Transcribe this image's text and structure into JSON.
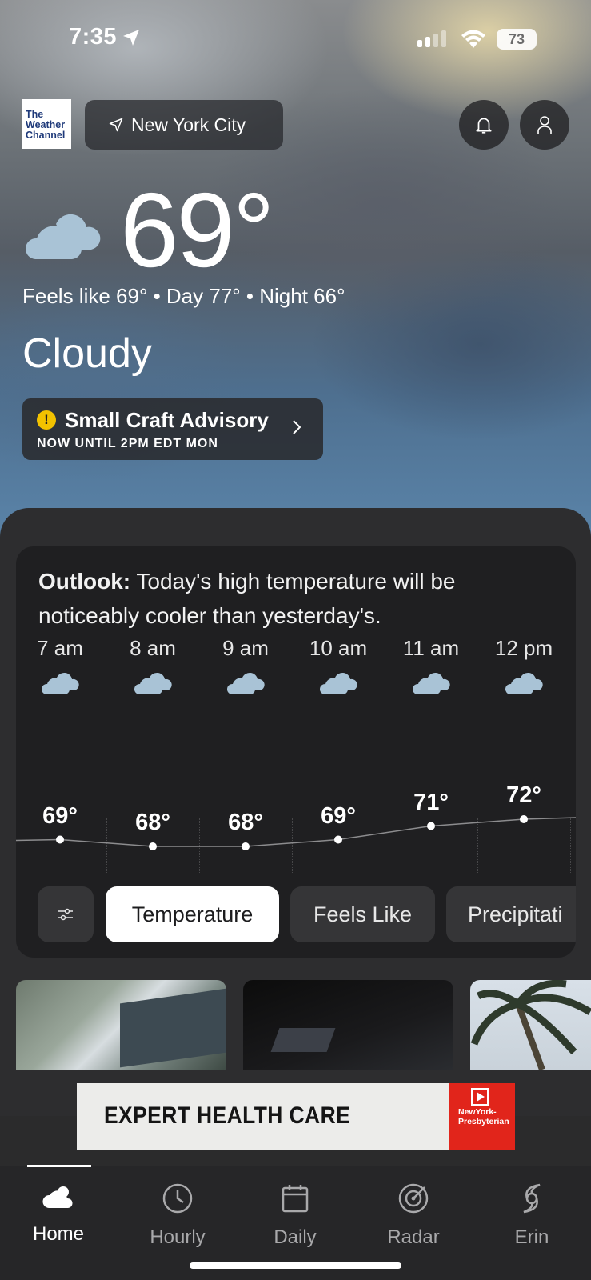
{
  "status_bar": {
    "time": "7:35",
    "battery": "73"
  },
  "header": {
    "logo_line1": "The",
    "logo_line2": "Weather",
    "logo_line3": "Channel",
    "location": "New York City"
  },
  "current": {
    "temperature": "69°",
    "feels_line": "Feels like 69° • Day 77° • Night 66°",
    "condition": "Cloudy"
  },
  "advisory": {
    "title": "Small Craft Advisory",
    "subtitle": "NOW UNTIL 2PM EDT MON"
  },
  "outlook": {
    "label": "Outlook:",
    "text": " Today's high temperature will be noticeably cooler than yesterday's."
  },
  "hourly": [
    {
      "time": "7 am",
      "temp": "69°",
      "value": 69
    },
    {
      "time": "8 am",
      "temp": "68°",
      "value": 68
    },
    {
      "time": "9 am",
      "temp": "68°",
      "value": 68
    },
    {
      "time": "10 am",
      "temp": "69°",
      "value": 69
    },
    {
      "time": "11 am",
      "temp": "71°",
      "value": 71
    },
    {
      "time": "12 pm",
      "temp": "72°",
      "value": 72
    }
  ],
  "chart_pills": {
    "temperature": "Temperature",
    "feels_like": "Feels Like",
    "precipitation": "Precipitati"
  },
  "ad": {
    "headline": "EXPERT HEALTH CARE",
    "brand_line1": "NewYork-",
    "brand_line2": "Presbyterian"
  },
  "tabs": {
    "home": "Home",
    "hourly": "Hourly",
    "daily": "Daily",
    "radar": "Radar",
    "storm": "Erin"
  },
  "colors": {
    "advisory_icon": "#f2c200",
    "ad_brand": "#e1251b",
    "cloud_icon": "#a9c3d6"
  }
}
